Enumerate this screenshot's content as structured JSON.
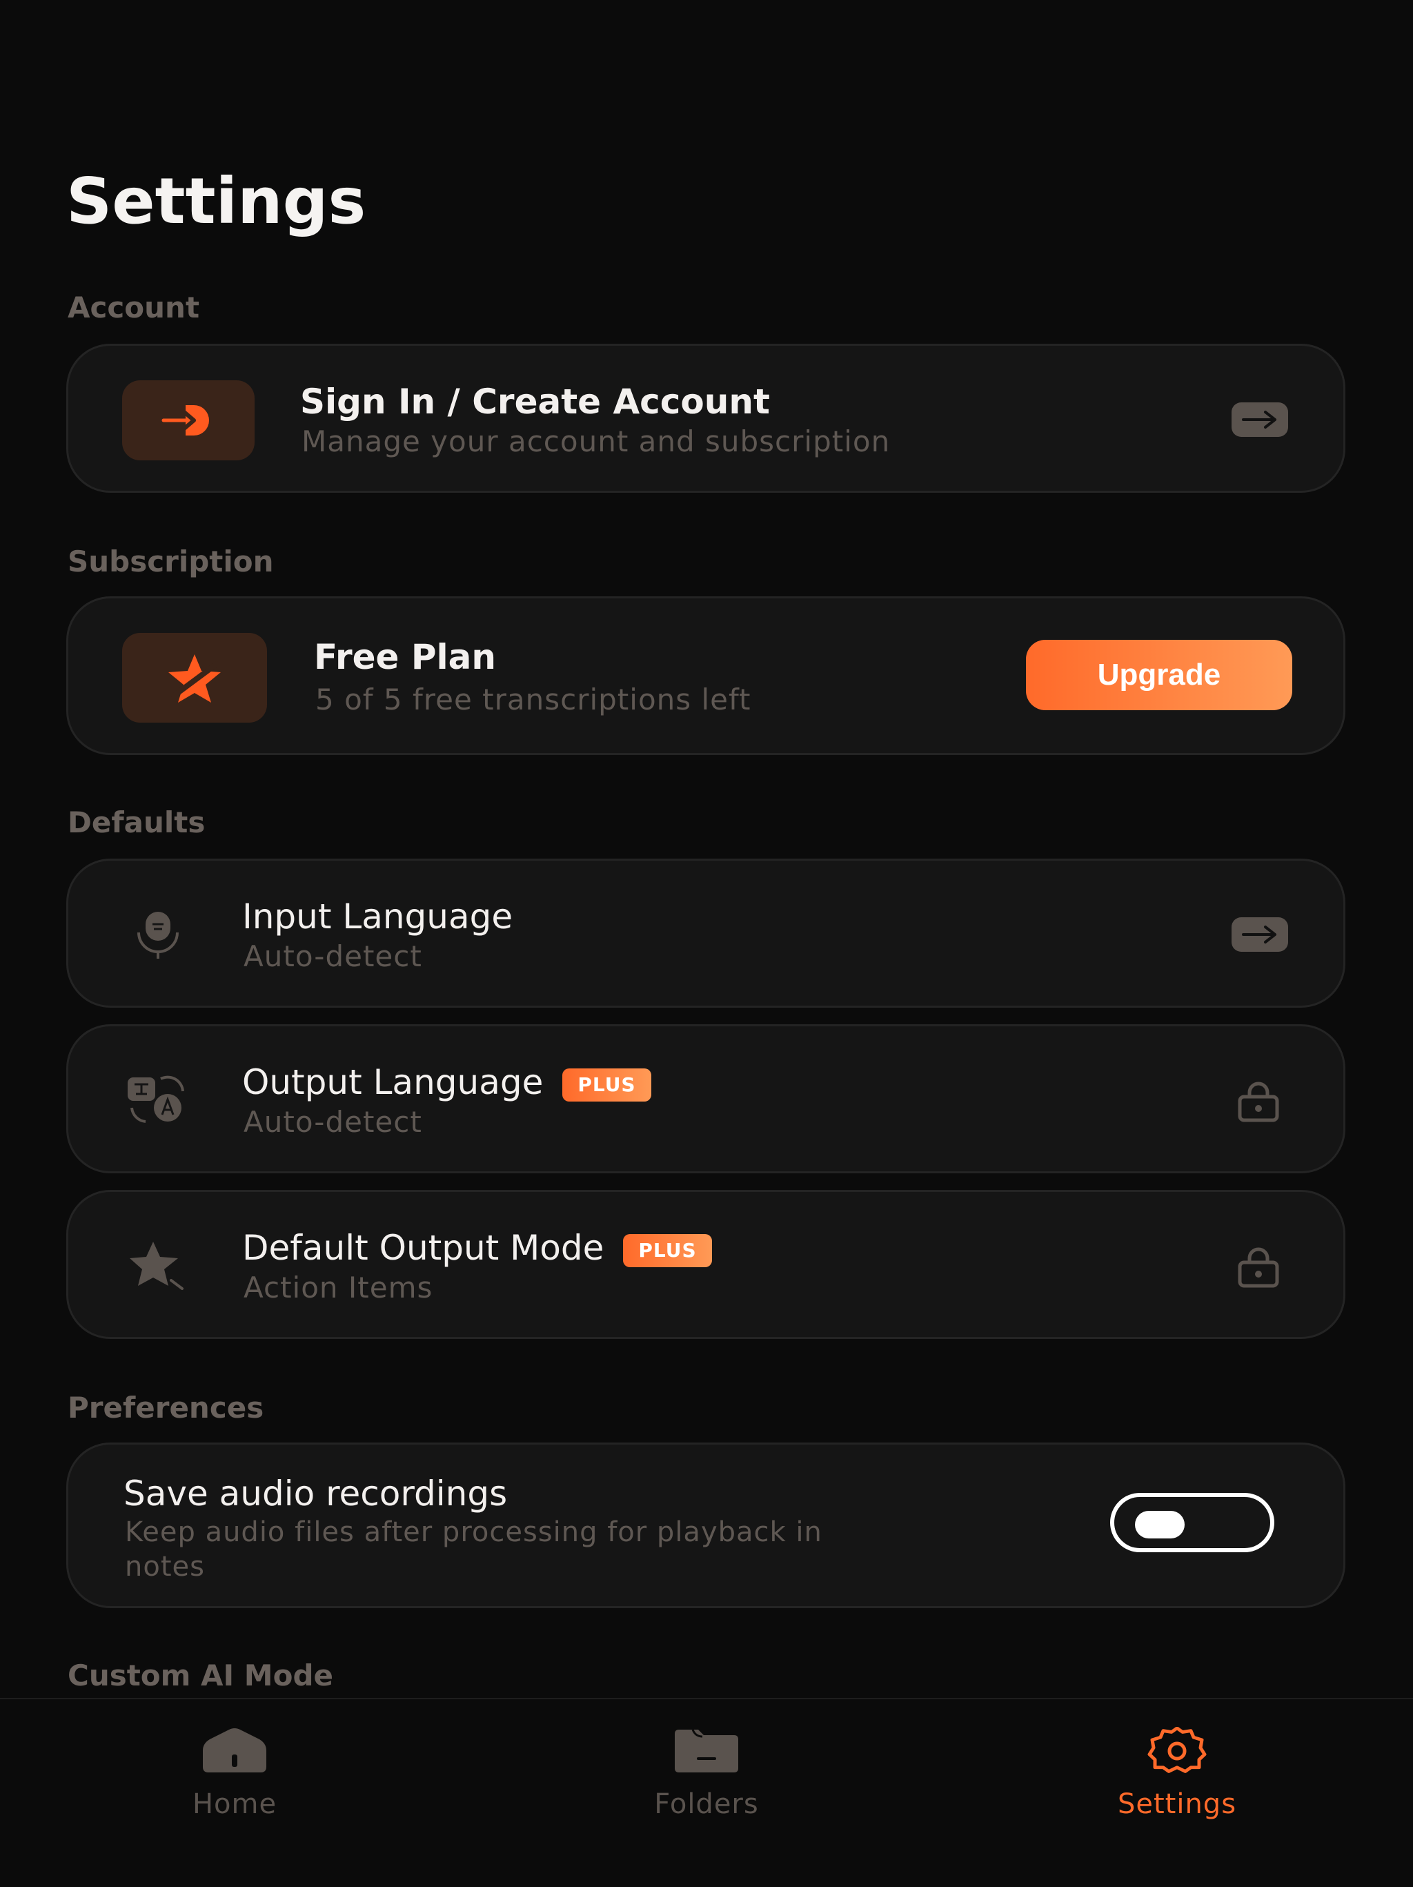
{
  "page": {
    "title": "Settings"
  },
  "colors": {
    "accent": "#ff6a2a",
    "background": "#0b0b0b",
    "card": "#151515",
    "muted": "#5f5853"
  },
  "sections": {
    "account": {
      "label": "Account",
      "sign_in": {
        "icon": "sign-in-icon",
        "title": "Sign In / Create Account",
        "subtitle": "Manage your account and subscription",
        "trailing_icon": "arrow-right-icon"
      }
    },
    "subscription": {
      "label": "Subscription",
      "plan": {
        "icon": "star-off-icon",
        "title": "Free Plan",
        "subtitle": "5 of 5 free transcriptions left",
        "upgrade_label": "Upgrade"
      }
    },
    "defaults": {
      "label": "Defaults",
      "input_language": {
        "icon": "microphone-icon",
        "title": "Input Language",
        "value": "Auto-detect",
        "trailing_icon": "arrow-right-icon"
      },
      "output_language": {
        "icon": "translate-icon",
        "title": "Output Language",
        "badge": "PLUS",
        "value": "Auto-detect",
        "trailing_icon": "lock-icon"
      },
      "output_mode": {
        "icon": "sparkle-star-icon",
        "title": "Default Output Mode",
        "badge": "PLUS",
        "value": "Action Items",
        "trailing_icon": "lock-icon"
      }
    },
    "preferences": {
      "label": "Preferences",
      "save_audio": {
        "title": "Save audio recordings",
        "subtitle_line1": "Keep audio files after processing for playback in",
        "subtitle_line2": "notes",
        "enabled": false
      }
    },
    "custom_ai": {
      "label": "Custom AI Mode"
    }
  },
  "tabbar": {
    "items": [
      {
        "label": "Home",
        "icon": "home-icon",
        "active": false
      },
      {
        "label": "Folders",
        "icon": "folder-icon",
        "active": false
      },
      {
        "label": "Settings",
        "icon": "gear-icon",
        "active": true
      }
    ]
  }
}
